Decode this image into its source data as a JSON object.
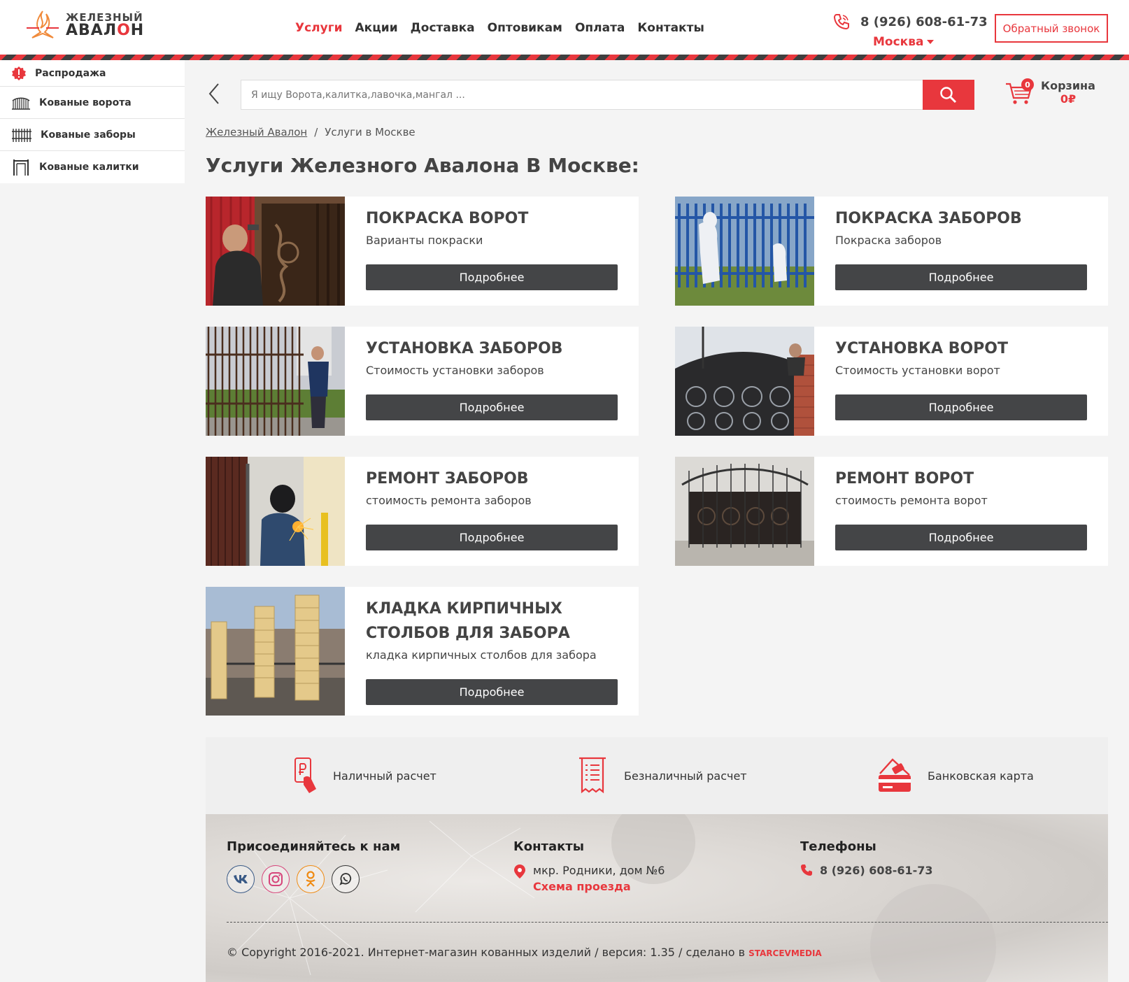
{
  "header": {
    "logo": {
      "line1": "ЖЕЛЕЗНЫЙ",
      "line2_a": "АВАЛ",
      "line2_b": "О",
      "line2_c": "Н"
    },
    "nav": [
      {
        "label": "Услуги",
        "active": true
      },
      {
        "label": "Акции"
      },
      {
        "label": "Доставка"
      },
      {
        "label": "Оптовикам"
      },
      {
        "label": "Оплата"
      },
      {
        "label": "Контакты"
      }
    ],
    "phone": "8 (926) 608-61-73",
    "city": "Москва",
    "callback_label": "Обратный звонок"
  },
  "sidebar": {
    "items": [
      {
        "label": "Распродажа",
        "icon": "sale-icon"
      },
      {
        "label": "Кованые ворота",
        "icon": "gate-icon"
      },
      {
        "label": "Кованые заборы",
        "icon": "fence-icon"
      },
      {
        "label": "Кованые калитки",
        "icon": "wicket-icon"
      }
    ]
  },
  "search": {
    "placeholder": "Я ищу Ворота,калитка,лавочка,мангал ..."
  },
  "cart": {
    "label": "Корзина",
    "count": "0",
    "sum": "0₽"
  },
  "breadcrumb": {
    "home": "Железный Авалон",
    "separator": "/",
    "current": "Услуги в Москве"
  },
  "page_title": "Услуги Железного Авалона В Москве:",
  "services": [
    {
      "title": "ПОКРАСКА ВОРОТ",
      "subtitle": "Варианты покраски",
      "button": "Подробнее"
    },
    {
      "title": "ПОКРАСКА ЗАБОРОВ",
      "subtitle": "Покраска заборов",
      "button": "Подробнее"
    },
    {
      "title": "УСТАНОВКА ЗАБОРОВ",
      "subtitle": "Стоимость установки заборов",
      "button": "Подробнее"
    },
    {
      "title": "УСТАНОВКА ВОРОТ",
      "subtitle": "Стоимость установки ворот",
      "button": "Подробнее"
    },
    {
      "title": "РЕМОНТ ЗАБОРОВ",
      "subtitle": "стоимость ремонта заборов",
      "button": "Подробнее"
    },
    {
      "title": "РЕМОНТ ВОРОТ",
      "subtitle": "стоимость ремонта ворот",
      "button": "Подробнее"
    },
    {
      "title": "КЛАДКА КИРПИЧНЫХ СТОЛБОВ ДЛЯ ЗАБОРА",
      "subtitle": "кладка кирпичных столбов для забора",
      "button": "Подробнее"
    }
  ],
  "payment": [
    {
      "label": "Наличный расчет",
      "icon": "cash-icon"
    },
    {
      "label": "Безналичный расчет",
      "icon": "invoice-icon"
    },
    {
      "label": "Банковская карта",
      "icon": "bank-card-icon"
    }
  ],
  "footer": {
    "join_title": "Присоединяйтесь к нам",
    "socials": [
      "vk-icon",
      "instagram-icon",
      "odnoklassniki-icon",
      "whatsapp-icon"
    ],
    "contacts_title": "Контакты",
    "address": "мкр. Родники, дом №6",
    "map_link": "Схема проезда",
    "phones_title": "Телефоны",
    "phone": "8 (926) 608-61-73",
    "copyright": "© Copyright 2016-2021. Интернет-магазин кованных изделий / версия: 1.35 / сделано в",
    "studio": "STARCEVMEDIA"
  },
  "colors": {
    "accent": "#e8373d",
    "button_dark": "#444547",
    "text": "#333333"
  }
}
